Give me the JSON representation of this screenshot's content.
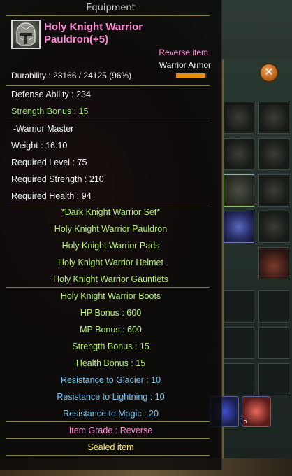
{
  "tooltip": {
    "header": "Equipment",
    "item_name": "Holy Knight Warrior Pauldron(+5)",
    "item_type_primary": "Reverse item",
    "item_type_secondary": "Warrior Armor",
    "durability": {
      "label": "Durability : 23166 / 24125 (96%)",
      "fraction": 0.96,
      "bar_color": "#ef8b14"
    },
    "stats": [
      "Defense Ability : 234",
      "Strength Bonus : 15",
      "-Warrior Master",
      "Weight : 16.10",
      "Required Level : 75",
      "Required Strength : 210",
      "Required Health : 94"
    ],
    "set_title": "*Dark Knight Warrior Set*",
    "set_items": [
      "Holy Knight Warrior Pauldron",
      "Holy Knight Warrior Pads",
      "Holy Knight Warrior Helmet",
      "Holy Knight Warrior Gauntlets",
      "Holy Knight Warrior Boots"
    ],
    "set_bonuses": [
      "HP Bonus : 600",
      "MP Bonus : 600",
      "Strength Bonus : 15",
      "Health Bonus : 15"
    ],
    "resistances": [
      "Resistance to Glacier : 10",
      "Resistance to Lightning : 10",
      "Resistance to Magic : 20"
    ],
    "item_grade": "Item Grade : Reverse",
    "sealed": "Sealed item",
    "icon": "knight-helmet-icon"
  },
  "inventory": {
    "close_icon": "close-icon",
    "close_glyph": "✕",
    "belt_count": "5"
  },
  "colors": {
    "item_name": "#ff8ad8",
    "set_text": "#b6ee77",
    "resistance_text": "#7cc3f0",
    "sealed_text": "#ffe96a"
  }
}
